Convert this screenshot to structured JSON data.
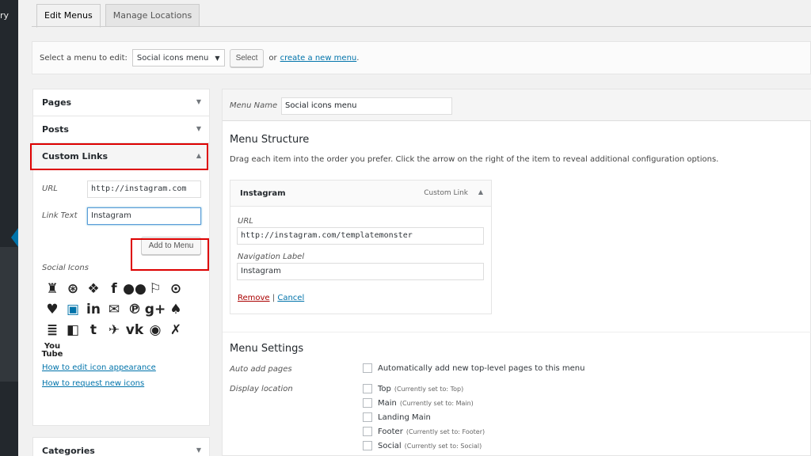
{
  "sidebar": {
    "cut_text": "ry"
  },
  "tabs": [
    {
      "label": "Edit Menus"
    },
    {
      "label": "Manage Locations"
    }
  ],
  "select_menu": {
    "label": "Select a menu to edit:",
    "selected": "Social icons menu",
    "button": "Select",
    "or": "or",
    "create_link": "create a new menu",
    "period": "."
  },
  "left": {
    "pages": "Pages",
    "posts": "Posts",
    "custom_links": "Custom Links",
    "url_label": "URL",
    "url_value": "http://instagram.com",
    "link_text_label": "Link Text",
    "link_text_value": "Instagram",
    "add_button": "Add to Menu",
    "social_icons_title": "Social Icons",
    "help_link_1": "How to edit icon appearance",
    "help_link_2": "How to request new icons",
    "categories": "Categories",
    "icons": [
      {
        "name": "untappd-icon",
        "glyph": "♜"
      },
      {
        "name": "dribbble-icon",
        "glyph": "⊛"
      },
      {
        "name": "dropbox-icon",
        "glyph": "❖"
      },
      {
        "name": "facebook-icon",
        "glyph": "f"
      },
      {
        "name": "flickr-icon",
        "glyph": "●●"
      },
      {
        "name": "foursquare-icon",
        "glyph": "⚐"
      },
      {
        "name": "github-icon",
        "glyph": "⊙"
      },
      {
        "name": "codepen-icon",
        "glyph": "♥"
      },
      {
        "name": "instagram-icon",
        "glyph": "▣"
      },
      {
        "name": "linkedin-icon",
        "glyph": "in"
      },
      {
        "name": "email-icon",
        "glyph": "✉"
      },
      {
        "name": "pinterest-icon",
        "glyph": "℗"
      },
      {
        "name": "google-plus-icon",
        "glyph": "g+"
      },
      {
        "name": "path-icon",
        "glyph": "♠"
      },
      {
        "name": "stackoverflow-icon",
        "glyph": "≣"
      },
      {
        "name": "trello-icon",
        "glyph": "◧"
      },
      {
        "name": "tumblr-icon",
        "glyph": "t"
      },
      {
        "name": "twitter-icon",
        "glyph": "✈"
      },
      {
        "name": "vk-icon",
        "glyph": "vk"
      },
      {
        "name": "weibo-icon",
        "glyph": "◉"
      },
      {
        "name": "xing-icon",
        "glyph": "✗"
      },
      {
        "name": "youtube-icon",
        "glyph": "You Tube"
      }
    ]
  },
  "right": {
    "menu_name_label": "Menu Name",
    "menu_name_value": "Social icons menu",
    "structure_title": "Menu Structure",
    "structure_desc": "Drag each item into the order you prefer. Click the arrow on the right of the item to reveal additional configuration options.",
    "item": {
      "title": "Instagram",
      "type": "Custom Link",
      "url_label": "URL",
      "url_value": "http://instagram.com/templatemonster",
      "nav_label": "Navigation Label",
      "nav_value": "Instagram",
      "remove": "Remove",
      "divider": "|",
      "cancel": "Cancel"
    },
    "settings_title": "Menu Settings",
    "auto_add_label": "Auto add pages",
    "auto_add_text": "Automatically add new top-level pages to this menu",
    "display_location_label": "Display location",
    "locations": [
      {
        "name": "Top",
        "note": "(Currently set to: Top)"
      },
      {
        "name": "Main",
        "note": "(Currently set to: Main)"
      },
      {
        "name": "Landing Main",
        "note": ""
      },
      {
        "name": "Footer",
        "note": "(Currently set to: Footer)"
      },
      {
        "name": "Social",
        "note": "(Currently set to: Social)"
      }
    ]
  },
  "colors": {
    "accent": "#0073aa",
    "highlight": "#dd0000",
    "admin_dark": "#23282d"
  }
}
